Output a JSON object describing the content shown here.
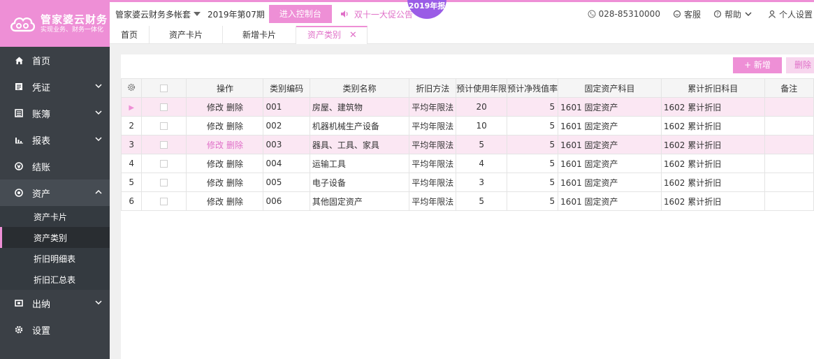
{
  "brand": {
    "name": "管家婆云财务",
    "slogan": "实现业务、财务一体化"
  },
  "sidebar": {
    "items": [
      {
        "key": "home",
        "label": "首页",
        "icon": "home-icon"
      },
      {
        "key": "voucher",
        "label": "凭证",
        "icon": "voucher-icon"
      },
      {
        "key": "ledger",
        "label": "账簿",
        "icon": "ledger-icon"
      },
      {
        "key": "report",
        "label": "报表",
        "icon": "bar-chart-icon"
      },
      {
        "key": "closing",
        "label": "结账",
        "icon": "closing-icon"
      },
      {
        "key": "assets",
        "label": "资产",
        "icon": "assets-icon"
      },
      {
        "key": "cashier",
        "label": "出纳",
        "icon": "cashier-icon"
      },
      {
        "key": "settings",
        "label": "设置",
        "icon": "gear-icon"
      }
    ],
    "asset_subitems": [
      {
        "label": "资产卡片"
      },
      {
        "label": "资产类别"
      },
      {
        "label": "折旧明细表"
      },
      {
        "label": "折旧汇总表"
      }
    ]
  },
  "topbar": {
    "account": "管家婆云财务多帐套",
    "period": "2019年第07期",
    "console_button": "进入控制台",
    "promo": "双十一大促公告",
    "badge": "2019年报",
    "phone": "028-85310000",
    "service": "客服",
    "help": "帮助",
    "user": "个人设置"
  },
  "tabs": [
    {
      "label": "首页"
    },
    {
      "label": "资产卡片"
    },
    {
      "label": "新增卡片"
    },
    {
      "label": "资产类别",
      "active": true
    }
  ],
  "toolbar": {
    "add_label": "+ 新增",
    "delete_label": "删除"
  },
  "table": {
    "headers": [
      "操作",
      "类别编码",
      "类别名称",
      "折旧方法",
      "预计使用年限",
      "预计净残值率",
      "固定资产科目",
      "累计折旧科目",
      "备注"
    ],
    "edit_label": "修改",
    "delete_label": "删除",
    "rows": [
      {
        "index": "",
        "code": "001",
        "name": "房屋、建筑物",
        "method": "平均年限法",
        "years": "20",
        "residual": "5",
        "asset_subject": "1601 固定资产",
        "dep_subject": "1602 累计折旧",
        "remark": ""
      },
      {
        "index": "2",
        "code": "002",
        "name": "机器机械生产设备",
        "method": "平均年限法",
        "years": "10",
        "residual": "5",
        "asset_subject": "1601 固定资产",
        "dep_subject": "1602 累计折旧",
        "remark": ""
      },
      {
        "index": "3",
        "code": "003",
        "name": "器具、工具、家具",
        "method": "平均年限法",
        "years": "5",
        "residual": "5",
        "asset_subject": "1601 固定资产",
        "dep_subject": "1602 累计折旧",
        "remark": ""
      },
      {
        "index": "4",
        "code": "004",
        "name": "运输工具",
        "method": "平均年限法",
        "years": "4",
        "residual": "5",
        "asset_subject": "1601 固定资产",
        "dep_subject": "1602 累计折旧",
        "remark": ""
      },
      {
        "index": "5",
        "code": "005",
        "name": "电子设备",
        "method": "平均年限法",
        "years": "3",
        "residual": "5",
        "asset_subject": "1601 固定资产",
        "dep_subject": "1602 累计折旧",
        "remark": ""
      },
      {
        "index": "6",
        "code": "006",
        "name": "其他固定资产",
        "method": "平均年限法",
        "years": "5",
        "residual": "5",
        "asset_subject": "1601 固定资产",
        "dep_subject": "1602 累计折旧",
        "remark": ""
      }
    ]
  },
  "colors": {
    "accent": "#ee8fd6",
    "accent_text": "#e070c8",
    "sidebar_bg": "#3b4046",
    "highlight_row": "#fbe7f3",
    "badge": "#9a5ce6"
  }
}
